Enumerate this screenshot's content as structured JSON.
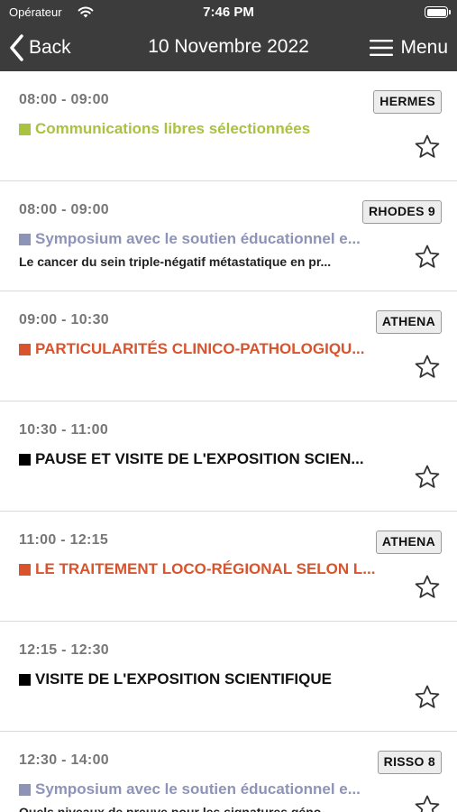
{
  "status_bar": {
    "carrier": "Opérateur",
    "time": "7:46 PM"
  },
  "nav": {
    "back_label": "Back",
    "title": "10 Novembre 2022",
    "menu_label": "Menu"
  },
  "sessions": [
    {
      "time": "08:00 - 09:00",
      "room": "HERMES",
      "title": "Communications libres sélectionnées",
      "subtitle": "",
      "color": "#a9c23f"
    },
    {
      "time": "08:00 - 09:00",
      "room": "RHODES 9",
      "title": "Symposium avec le soutien éducationnel e...",
      "subtitle": "Le cancer du sein triple-négatif métastatique en pr...",
      "color": "#8e93b8"
    },
    {
      "time": "09:00 - 10:30",
      "room": "ATHENA",
      "title": "PARTICULARITÉS CLINICO-PATHOLOGIQU...",
      "subtitle": "",
      "color": "#d9532c"
    },
    {
      "time": "10:30 - 11:00",
      "room": "",
      "title": "PAUSE ET VISITE DE L'EXPOSITION SCIEN...",
      "subtitle": "",
      "color": "#000000"
    },
    {
      "time": "11:00 - 12:15",
      "room": "ATHENA",
      "title": "LE TRAITEMENT LOCO-RÉGIONAL SELON L...",
      "subtitle": "",
      "color": "#d9532c"
    },
    {
      "time": "12:15 - 12:30",
      "room": "",
      "title": "VISITE DE L'EXPOSITION SCIENTIFIQUE",
      "subtitle": "",
      "color": "#000000"
    },
    {
      "time": "12:30 - 14:00",
      "room": "RISSO 8",
      "title": "Symposium avec le soutien éducationnel e...",
      "subtitle": "Quels niveaux de preuve pour les signatures géno...",
      "color": "#8e93b8"
    }
  ],
  "icons": {
    "back": "chevron-left-icon",
    "menu": "hamburger-icon",
    "favorite": "star-outline-icon",
    "wifi": "wifi-icon",
    "battery": "battery-icon"
  }
}
